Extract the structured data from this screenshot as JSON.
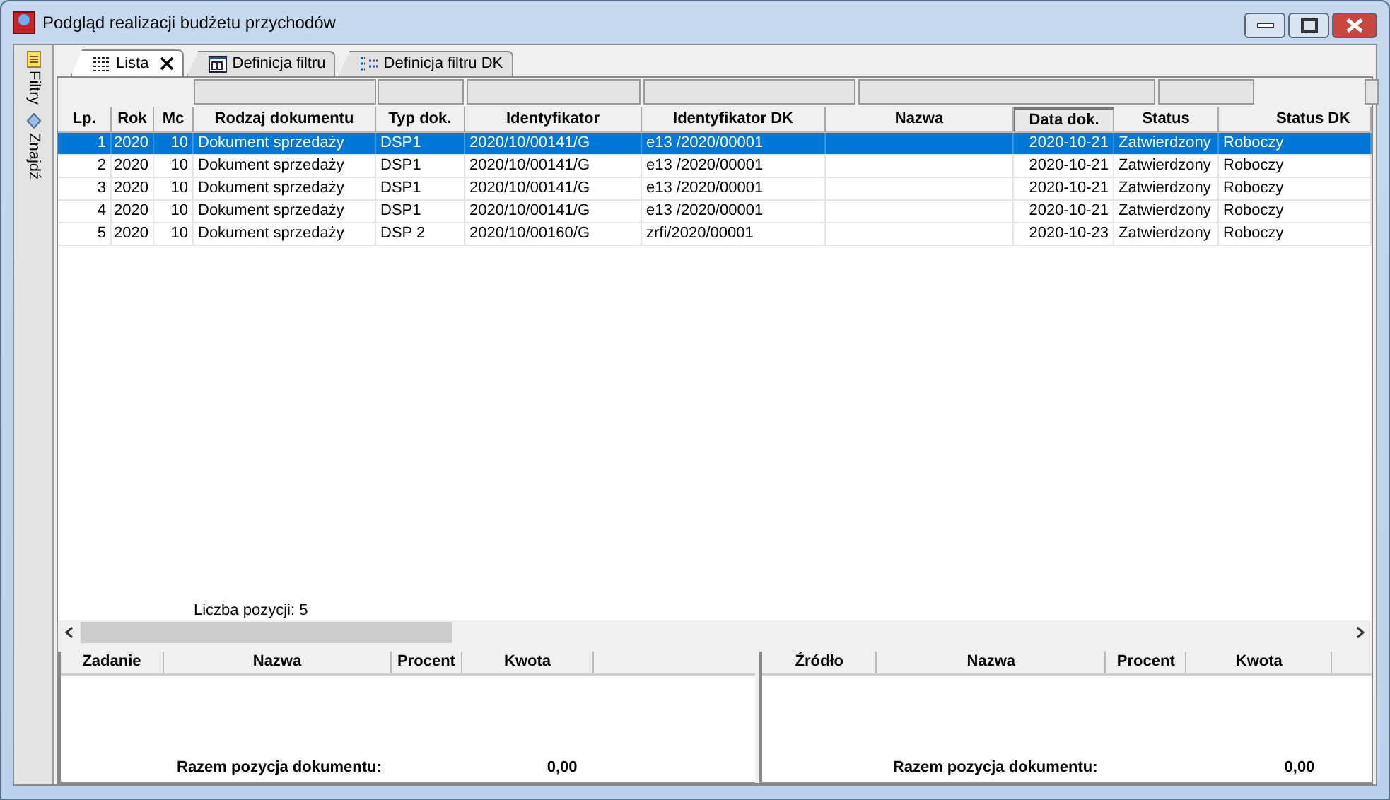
{
  "window": {
    "title": "Podgląd realizacji budżetu przychodów"
  },
  "side_tabs": [
    {
      "label": "Filtry"
    },
    {
      "label": "Znajdź"
    }
  ],
  "tabs": [
    {
      "label": "Lista",
      "selected": true,
      "closable": true
    },
    {
      "label": "Definicja filtru",
      "selected": false,
      "closable": false
    },
    {
      "label": "Definicja filtru DK",
      "selected": false,
      "closable": false
    }
  ],
  "table": {
    "columns": [
      {
        "label": "Lp.",
        "sorted": false
      },
      {
        "label": "Rok",
        "sorted": false
      },
      {
        "label": "Mc",
        "sorted": false
      },
      {
        "label": "Rodzaj dokumentu",
        "sorted": false
      },
      {
        "label": "Typ dok.",
        "sorted": false
      },
      {
        "label": "Identyfikator",
        "sorted": false
      },
      {
        "label": "Identyfikator DK",
        "sorted": false
      },
      {
        "label": "Nazwa",
        "sorted": false
      },
      {
        "label": "Data dok.",
        "sorted": true
      },
      {
        "label": "Status",
        "sorted": false
      },
      {
        "label": "Status DK",
        "sorted": false
      }
    ],
    "rows": [
      {
        "selected": true,
        "cells": [
          "1",
          "2020",
          "10",
          "Dokument sprzedaży",
          "DSP1",
          "2020/10/00141/G",
          "e13 /2020/00001",
          "",
          "2020-10-21",
          "Zatwierdzony",
          "Roboczy"
        ]
      },
      {
        "selected": false,
        "cells": [
          "2",
          "2020",
          "10",
          "Dokument sprzedaży",
          "DSP1",
          "2020/10/00141/G",
          "e13 /2020/00001",
          "",
          "2020-10-21",
          "Zatwierdzony",
          "Roboczy"
        ]
      },
      {
        "selected": false,
        "cells": [
          "3",
          "2020",
          "10",
          "Dokument sprzedaży",
          "DSP1",
          "2020/10/00141/G",
          "e13 /2020/00001",
          "",
          "2020-10-21",
          "Zatwierdzony",
          "Roboczy"
        ]
      },
      {
        "selected": false,
        "cells": [
          "4",
          "2020",
          "10",
          "Dokument sprzedaży",
          "DSP1",
          "2020/10/00141/G",
          "e13 /2020/00001",
          "",
          "2020-10-21",
          "Zatwierdzony",
          "Roboczy"
        ]
      },
      {
        "selected": false,
        "cells": [
          "5",
          "2020",
          "10",
          "Dokument sprzedaży",
          "DSP 2",
          "2020/10/00160/G",
          "zrfi/2020/00001",
          "",
          "2020-10-23",
          "Zatwierdzony",
          "Roboczy"
        ]
      }
    ],
    "count": "Liczba pozycji: 5"
  },
  "bottom_tables": [
    {
      "columns": [
        "Zadanie",
        "Nazwa",
        "Procent",
        "Kwota"
      ],
      "total_label": "Razem pozycja dokumentu:",
      "total_value": "0,00"
    },
    {
      "columns": [
        "Źródło",
        "Nazwa",
        "Procent",
        "Kwota"
      ],
      "total_label": "Razem pozycja dokumentu:",
      "total_value": "0,00"
    }
  ]
}
